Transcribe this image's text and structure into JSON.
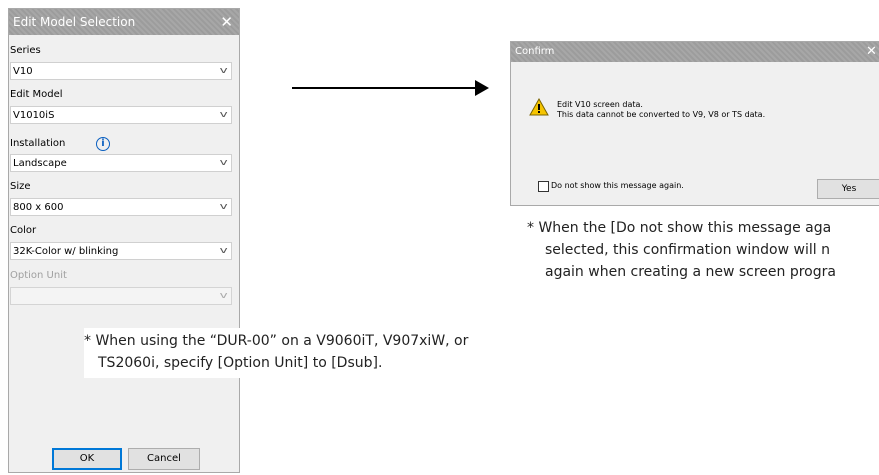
{
  "edit_dialog": {
    "title": "Edit Model Selection",
    "close_glyph": "✕",
    "series": {
      "label": "Series",
      "value": "V10"
    },
    "edit_model": {
      "label": "Edit Model",
      "value": "V1010iS"
    },
    "installation": {
      "label": "Installation",
      "value": "Landscape",
      "info_glyph": "i"
    },
    "size": {
      "label": "Size",
      "value": "800 x 600"
    },
    "color": {
      "label": "Color",
      "value": "32K-Color w/  blinking"
    },
    "option_unit": {
      "label": "Option Unit",
      "value": ""
    },
    "chevron_glyph": "v",
    "ok_label": "OK",
    "cancel_label": "Cancel"
  },
  "confirm_dialog": {
    "title": "Confirm",
    "close_glyph": "✕",
    "message_line1": "Edit V10 screen data.",
    "message_line2": "This data cannot be converted to V9, V8 or TS data.",
    "checkbox_label": "Do not show this message again.",
    "checkbox_checked": false,
    "yes_label": "Yes"
  },
  "notes": {
    "option_unit_note_line1": "* When using the “DUR-00” on a V9060iT, V907xiW, or",
    "option_unit_note_line2": "TS2060i, specify [Option Unit] to [Dsub].",
    "confirm_note_line1": "* When the [Do not show this message aga",
    "confirm_note_line2": "selected, this confirmation window will n",
    "confirm_note_line3": "again when creating a new screen progra"
  },
  "colors": {
    "titlebar": "#a2a2a2",
    "dialog_bg": "#f0f0f0",
    "info_blue": "#0a5fc0",
    "warning_yellow": "#f5c400",
    "default_button_border": "#0078d7"
  }
}
